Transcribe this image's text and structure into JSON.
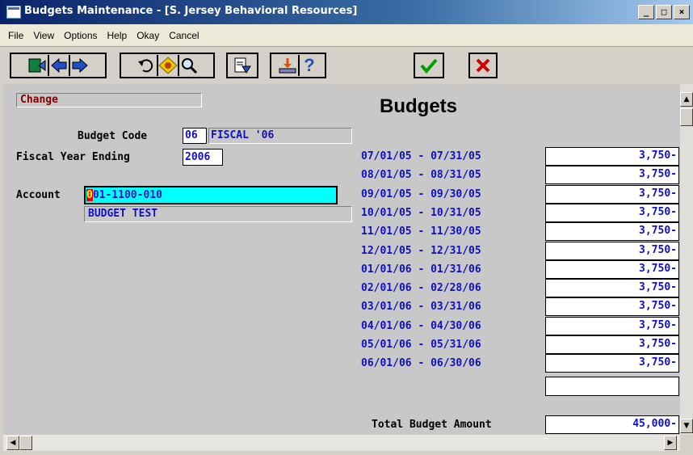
{
  "window": {
    "title": "Budgets Maintenance - [S. Jersey Behavioral Resources]"
  },
  "window_buttons": [
    "_",
    "□",
    "×"
  ],
  "menu": [
    "File",
    "View",
    "Options",
    "Help",
    "Okay",
    "Cancel"
  ],
  "toolbar": {
    "icons": [
      "exit-icon",
      "back-arrow-icon",
      "forward-arrow-icon",
      "undo-icon",
      "diamond-icon",
      "search-icon",
      "document-icon",
      "download-icon",
      "help-icon",
      "ok-check-icon",
      "cancel-x-icon"
    ],
    "help_glyph": "?",
    "colors": {
      "arrow": "#1e50c8",
      "ok": "#00a000",
      "cancel": "#d00000",
      "exit": "#108040"
    }
  },
  "form": {
    "mode": "Change",
    "heading": "Budgets",
    "budget_code_label": "Budget Code",
    "budget_code": "06",
    "budget_code_desc": "FISCAL '06",
    "fiscal_year_label": "Fiscal Year Ending",
    "fiscal_year": "2006",
    "account_label": "Account",
    "account_cursor": "0",
    "account_rest": "01-1100-010",
    "account_desc": "BUDGET TEST",
    "total_label": "Total Budget Amount",
    "total_value": "45,000-"
  },
  "periods": [
    {
      "range": "07/01/05 - 07/31/05",
      "amount": "3,750-"
    },
    {
      "range": "08/01/05 - 08/31/05",
      "amount": "3,750-"
    },
    {
      "range": "09/01/05 - 09/30/05",
      "amount": "3,750-"
    },
    {
      "range": "10/01/05 - 10/31/05",
      "amount": "3,750-"
    },
    {
      "range": "11/01/05 - 11/30/05",
      "amount": "3,750-"
    },
    {
      "range": "12/01/05 - 12/31/05",
      "amount": "3,750-"
    },
    {
      "range": "01/01/06 - 01/31/06",
      "amount": "3,750-"
    },
    {
      "range": "02/01/06 - 02/28/06",
      "amount": "3,750-"
    },
    {
      "range": "03/01/06 - 03/31/06",
      "amount": "3,750-"
    },
    {
      "range": "04/01/06 - 04/30/06",
      "amount": "3,750-"
    },
    {
      "range": "05/01/06 - 05/31/06",
      "amount": "3,750-"
    },
    {
      "range": "06/01/06 - 06/30/06",
      "amount": "3,750-"
    }
  ],
  "colors": {
    "field_text": "#1010c0",
    "account_highlight": "#00ffff",
    "mode_text": "#800000",
    "cursor_bg": "#e00000"
  }
}
